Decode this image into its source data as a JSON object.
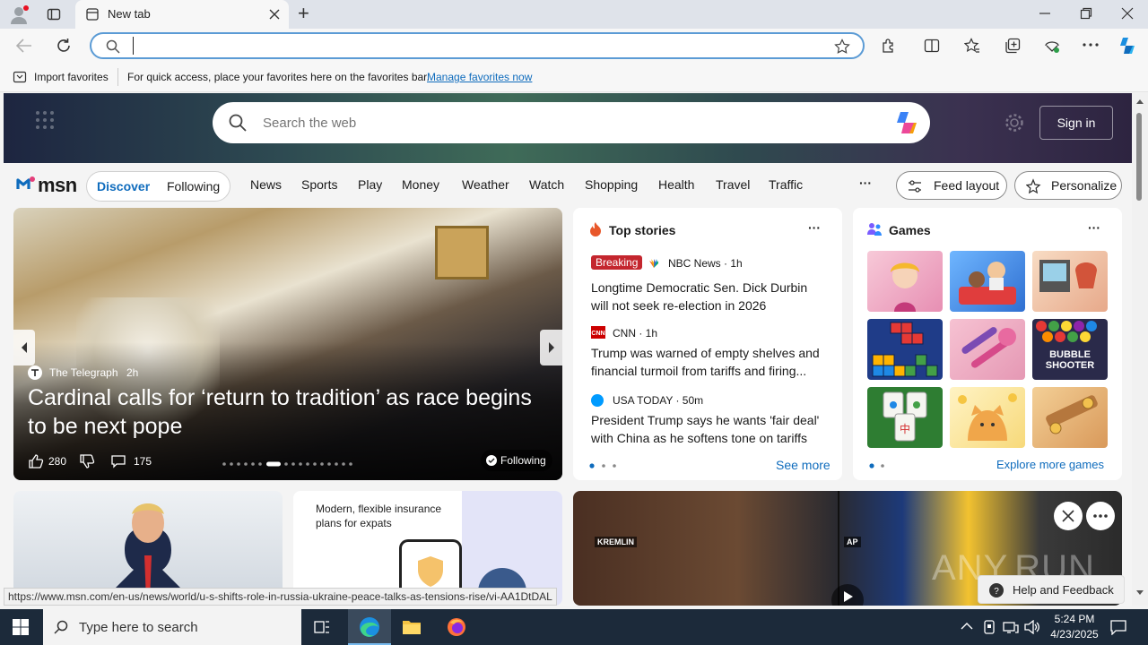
{
  "browser": {
    "tab_title": "New tab",
    "new_tab_symbol": "+",
    "address_value": "",
    "favorites_bar": {
      "import_label": "Import favorites",
      "hint": "For quick access, place your favorites here on the favorites bar.",
      "manage_link": "Manage favorites now"
    },
    "status_url": "https://www.msn.com/en-us/news/world/u-s-shifts-role-in-russia-ukraine-peace-talks-as-tensions-rise/vi-AA1DtDAL"
  },
  "msn": {
    "search_placeholder": "Search the web",
    "sign_in": "Sign in",
    "logo_text": "msn",
    "feed_tabs": [
      "Discover",
      "Following"
    ],
    "nav_items": [
      "News",
      "Sports",
      "Play",
      "Money",
      "Weather",
      "Watch",
      "Shopping",
      "Health",
      "Travel",
      "Traffic"
    ],
    "more": "···",
    "feed_layout": "Feed layout",
    "personalize": "Personalize"
  },
  "carousel": {
    "source": "The Telegraph",
    "age": "2h",
    "headline": "Cardinal calls for ‘return to tradition’ as race begins to be next pope",
    "likes": "280",
    "comments": "175",
    "following": "Following"
  },
  "top_stories": {
    "title": "Top stories",
    "more": "···",
    "items": [
      {
        "badge": "Breaking",
        "source": "NBC News · 1h",
        "headline": "Longtime Democratic Sen. Dick Durbin will not seek re-election in 2026"
      },
      {
        "badge": "",
        "source": "CNN · 1h",
        "headline": "Trump was warned of empty shelves and financial turmoil from tariffs and firing..."
      },
      {
        "badge": "",
        "source": "USA TODAY · 50m",
        "headline": "President Trump says he wants 'fair deal' with China as he softens tone on tariffs"
      }
    ],
    "see_more": "See more"
  },
  "games": {
    "title": "Games",
    "more": "···",
    "explore": "Explore more games",
    "tiles": [
      {
        "name": "dress-up-game",
        "color": "#f3b6c8"
      },
      {
        "name": "waiter-game",
        "color": "#4a8fd8"
      },
      {
        "name": "cafe-game",
        "color": "#f0c9a8"
      },
      {
        "name": "blocks-game",
        "color": "#1f3c88"
      },
      {
        "name": "makeup-game",
        "color": "#f2b5c9"
      },
      {
        "name": "bubble-shooter-game",
        "color": "#2a2a4a"
      },
      {
        "name": "mahjong-game",
        "color": "#2e7d32"
      },
      {
        "name": "cat-game",
        "color": "#fbe3a0"
      },
      {
        "name": "wood-puzzle-game",
        "color": "#e8b878"
      }
    ],
    "bubble_text": "BUBBLE SHOOTER"
  },
  "ad_card": {
    "text": "Modern, flexible insurance plans for expats"
  },
  "video_card": {
    "labels": [
      "KREMLIN",
      "AP"
    ]
  },
  "help_feedback": "Help and Feedback",
  "watermark": "ANY.RUN",
  "taskbar": {
    "search_placeholder": "Type here to search",
    "time": "5:24 PM",
    "date": "4/23/2025"
  },
  "colors": {
    "accent": "#0f6cbd",
    "breaking": "#c4262e",
    "taskbar": "#1c2a3a"
  }
}
